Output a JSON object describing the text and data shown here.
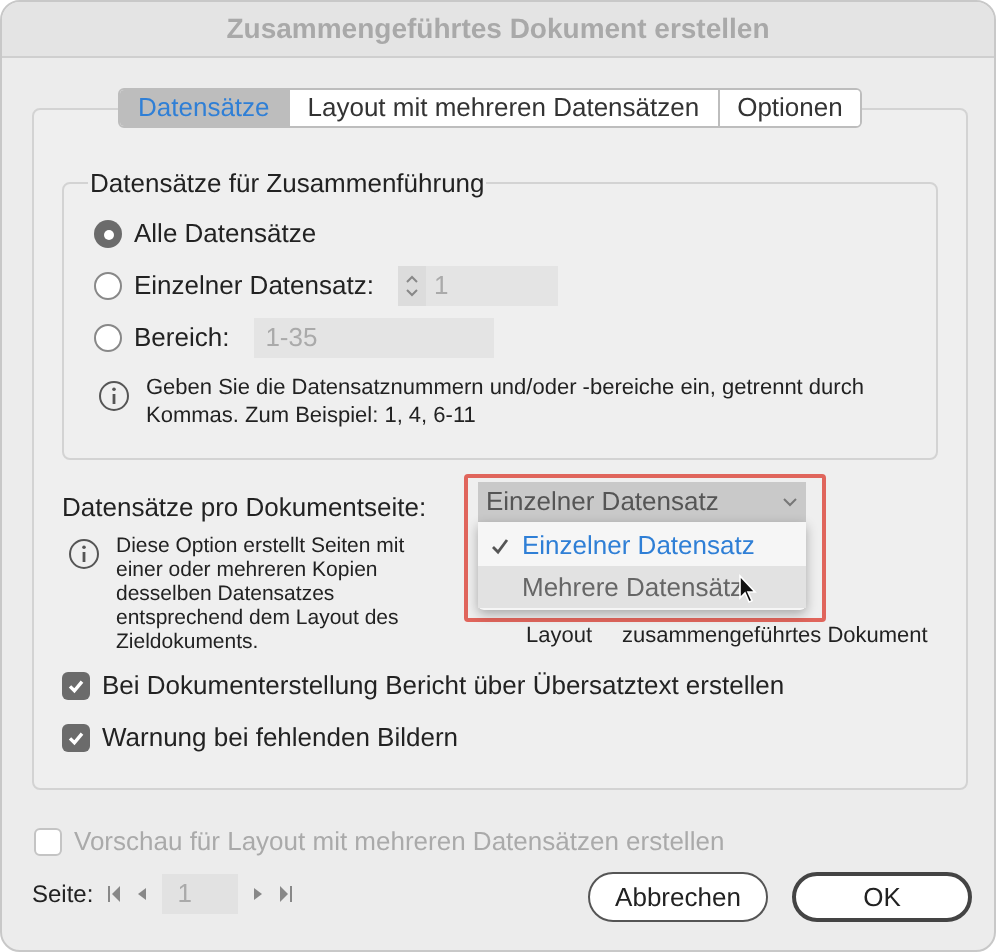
{
  "window": {
    "title": "Zusammengeführtes Dokument erstellen"
  },
  "tabs": [
    {
      "label": "Datensätze",
      "selected": true
    },
    {
      "label": "Layout mit mehreren Datensätzen",
      "selected": false
    },
    {
      "label": "Optionen",
      "selected": false
    }
  ],
  "record_group": {
    "title": "Datensätze für Zusammenführung",
    "options": [
      {
        "kind": "plain",
        "label": "Alle Datensätze",
        "selected": true
      },
      {
        "kind": "stepper",
        "label": "Einzelner Datensatz:",
        "value": "1",
        "selected": false
      },
      {
        "kind": "field",
        "label": "Bereich:",
        "value": "1-35",
        "selected": false
      }
    ],
    "hint": "Geben Sie die Datensatznummern und/oder -bereiche ein, getrennt durch Kommas. Zum Beispiel: 1, 4, 6-11"
  },
  "records_per_page": {
    "label": "Datensätze pro Dokumentseite:",
    "dropdown": {
      "value": "Einzelner Datensatz",
      "menu": [
        {
          "label": "Einzelner Datensatz",
          "selected": true,
          "hovered": false
        },
        {
          "label": "Mehrere Datensätz",
          "selected": false,
          "hovered": true
        }
      ]
    },
    "hint": "Diese Option erstellt Seiten mit einer oder mehreren Kopien desselben Datensatzes entsprechend dem Layout des Zieldokuments.",
    "behind_menu": [
      "Layout",
      "zusammengeführtes Dokument"
    ]
  },
  "checkboxes": [
    {
      "label": "Bei Dokumenterstellung Bericht über Übersatztext erstellen",
      "checked": true
    },
    {
      "label": "Warnung bei fehlenden Bildern",
      "checked": true
    }
  ],
  "preview": {
    "label": "Vorschau für Layout mit mehreren Datensätzen erstellen",
    "checked": false,
    "disabled": true
  },
  "pager": {
    "label": "Seite:",
    "value": "1"
  },
  "buttons": [
    {
      "label": "Abbrechen",
      "default": false
    },
    {
      "label": "OK",
      "default": true
    }
  ]
}
